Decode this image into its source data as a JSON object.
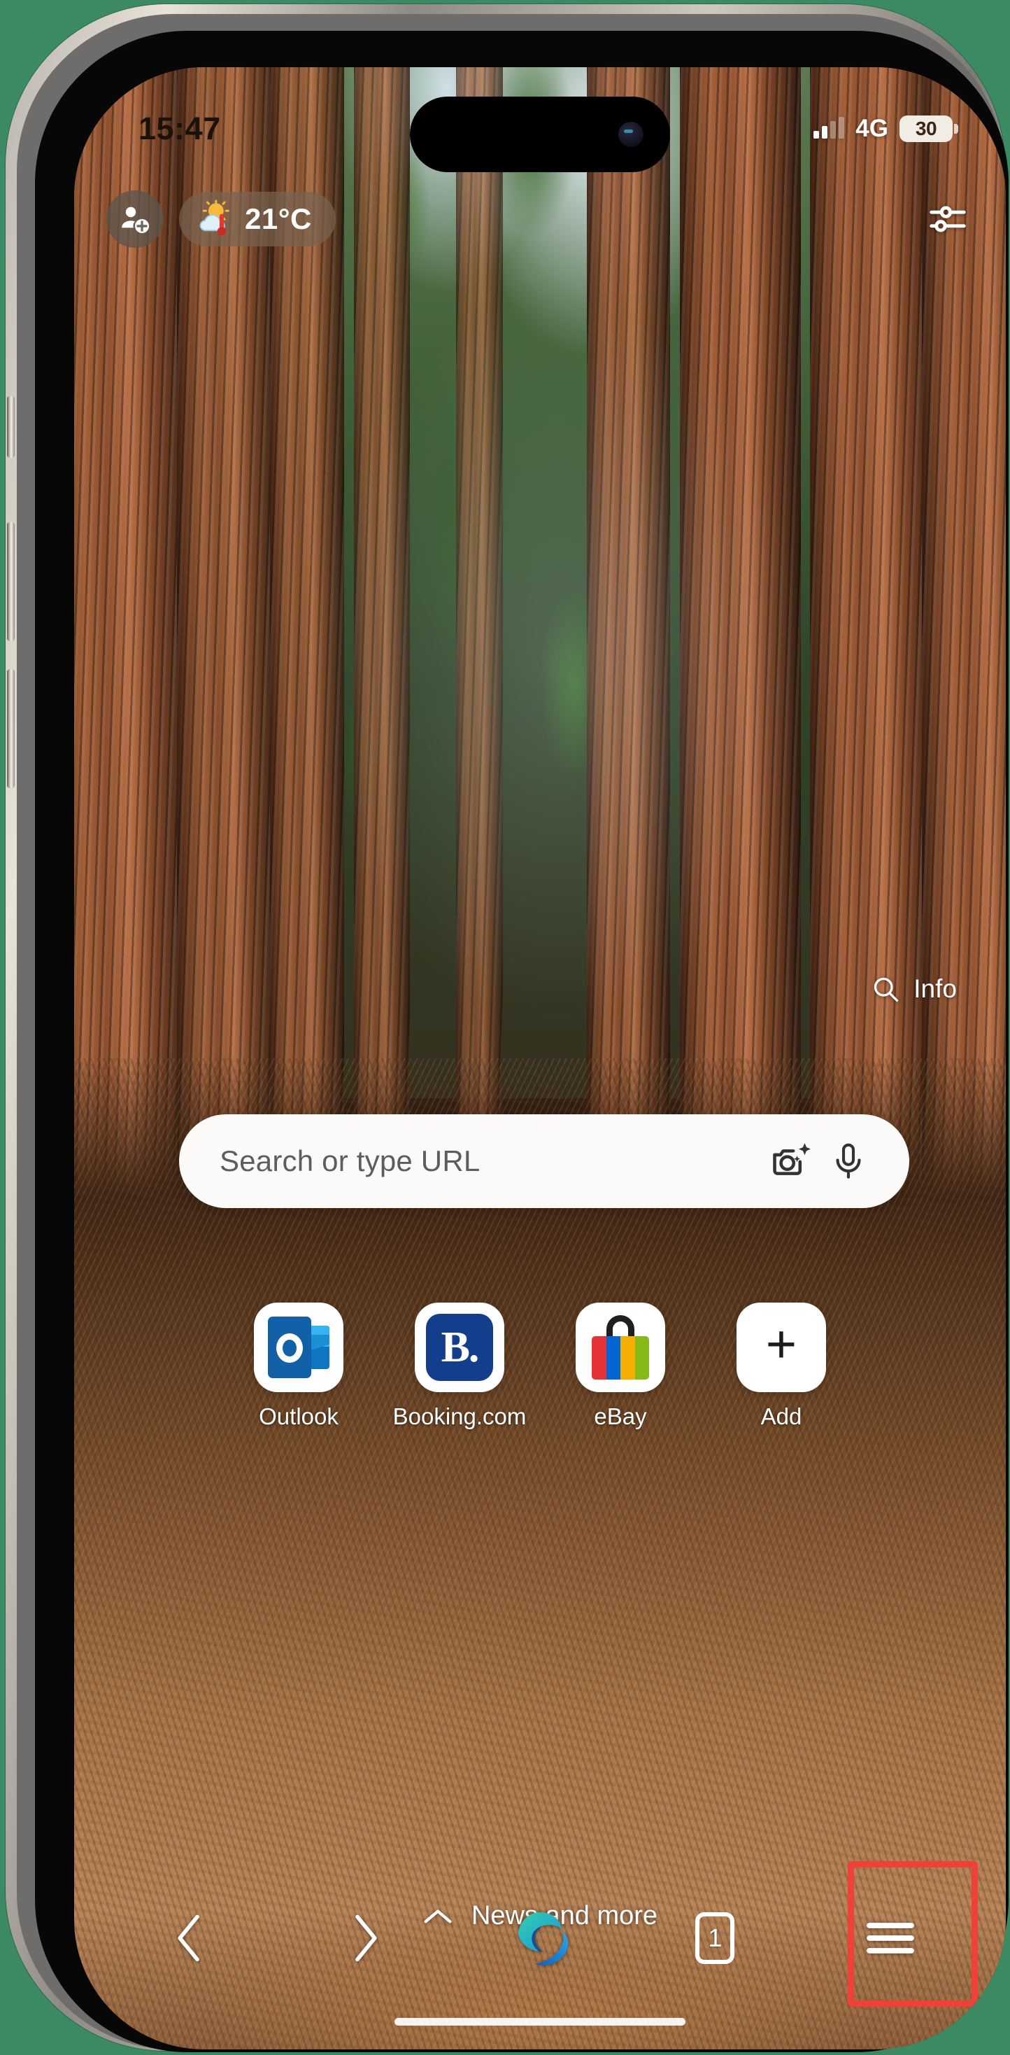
{
  "device": {
    "label": "iphone-15-pro-titanium",
    "frame_color": "#cfc8bd",
    "background_color": "#3b8a62"
  },
  "status_bar": {
    "time": "15:47",
    "signal_icon": "cellular-signal-icon",
    "network_label": "4G",
    "battery_level": "30",
    "battery_icon": "battery-icon"
  },
  "top_bar": {
    "profile_icon": "add-profile-icon",
    "profile_label": "Add profile",
    "weather": {
      "icon": "sun-cloud-thermometer-icon",
      "temperature": "21°C"
    },
    "settings_icon": "tune-sliders-icon",
    "settings_label": "Customize"
  },
  "info_row": {
    "icon": "search-magnifier-icon",
    "label": "Info"
  },
  "search": {
    "placeholder": "Search or type URL",
    "value": "",
    "lens_icon": "camera-lens-sparkle-icon",
    "voice_icon": "microphone-icon"
  },
  "shortcuts": [
    {
      "label": "Outlook",
      "icon": "outlook-icon"
    },
    {
      "label": "Booking.com",
      "icon": "booking-com-icon",
      "glyph": "B."
    },
    {
      "label": "eBay",
      "icon": "ebay-shopping-bag-icon"
    },
    {
      "label": "Add",
      "icon": "plus-icon",
      "glyph": "+"
    }
  ],
  "feed": {
    "chevron_icon": "chevron-up-icon",
    "label": "News and more"
  },
  "bottom_nav": {
    "back_icon": "chevron-left-icon",
    "back_label": "Back",
    "forward_icon": "chevron-right-icon",
    "forward_label": "Forward",
    "home_icon": "edge-logo-icon",
    "home_label": "Edge",
    "tabs_icon": "tab-counter-icon",
    "tab_count": "1",
    "menu_icon": "hamburger-menu-icon",
    "menu_label": "Settings and more"
  },
  "annotation": {
    "highlight_color": "#ef4136",
    "highlight_target": "hamburger-menu-icon"
  }
}
